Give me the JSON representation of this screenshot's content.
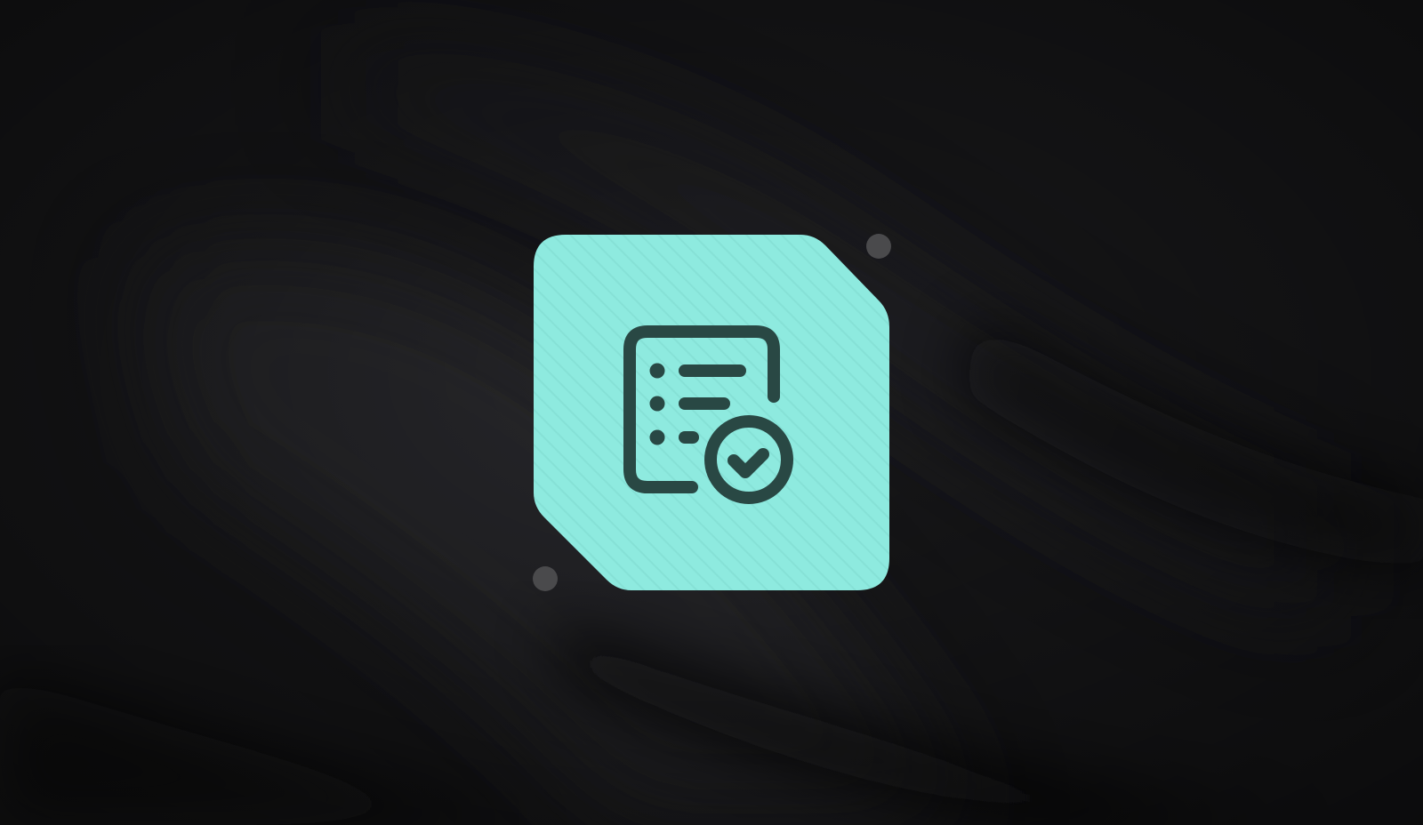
{
  "scene": {
    "background_color": "#18181a",
    "badge_color": "#8eeadf",
    "icon_color": "#294844",
    "accent_dot_color": "#4a4a4c"
  },
  "icon": {
    "name": "task-list-check-icon"
  }
}
